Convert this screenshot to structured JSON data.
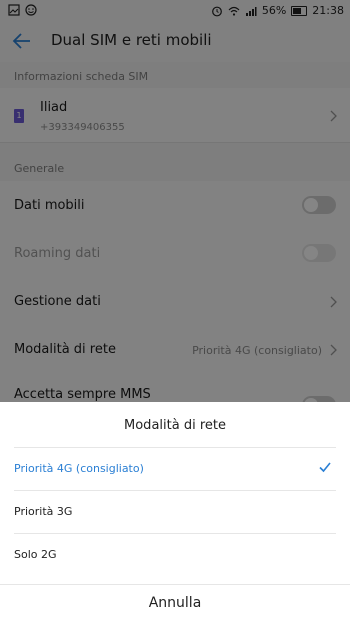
{
  "status_bar": {
    "battery": "56%",
    "time": "21:38"
  },
  "header": {
    "title": "Dual SIM e reti mobili"
  },
  "sim_section": {
    "label": "Informazioni scheda SIM",
    "sim_name": "Iliad",
    "sim_number": "+393349406355",
    "sim_badge": "1"
  },
  "general_section": {
    "label": "Generale",
    "items": [
      {
        "label": "Dati mobili"
      },
      {
        "label": "Roaming dati"
      },
      {
        "label": "Gestione dati"
      },
      {
        "label": "Modalità di rete",
        "value": "Priorità 4G (consigliato)"
      },
      {
        "label": "Accetta sempre MMS"
      }
    ]
  },
  "sheet": {
    "title": "Modalità di rete",
    "options": [
      {
        "label": "Priorità 4G (consigliato)",
        "selected": true
      },
      {
        "label": "Priorità 3G",
        "selected": false
      },
      {
        "label": "Solo 2G",
        "selected": false
      }
    ],
    "cancel_label": "Annulla"
  },
  "colors": {
    "accent": "#2a7fd4",
    "sim_badge": "#6b5bd6"
  }
}
